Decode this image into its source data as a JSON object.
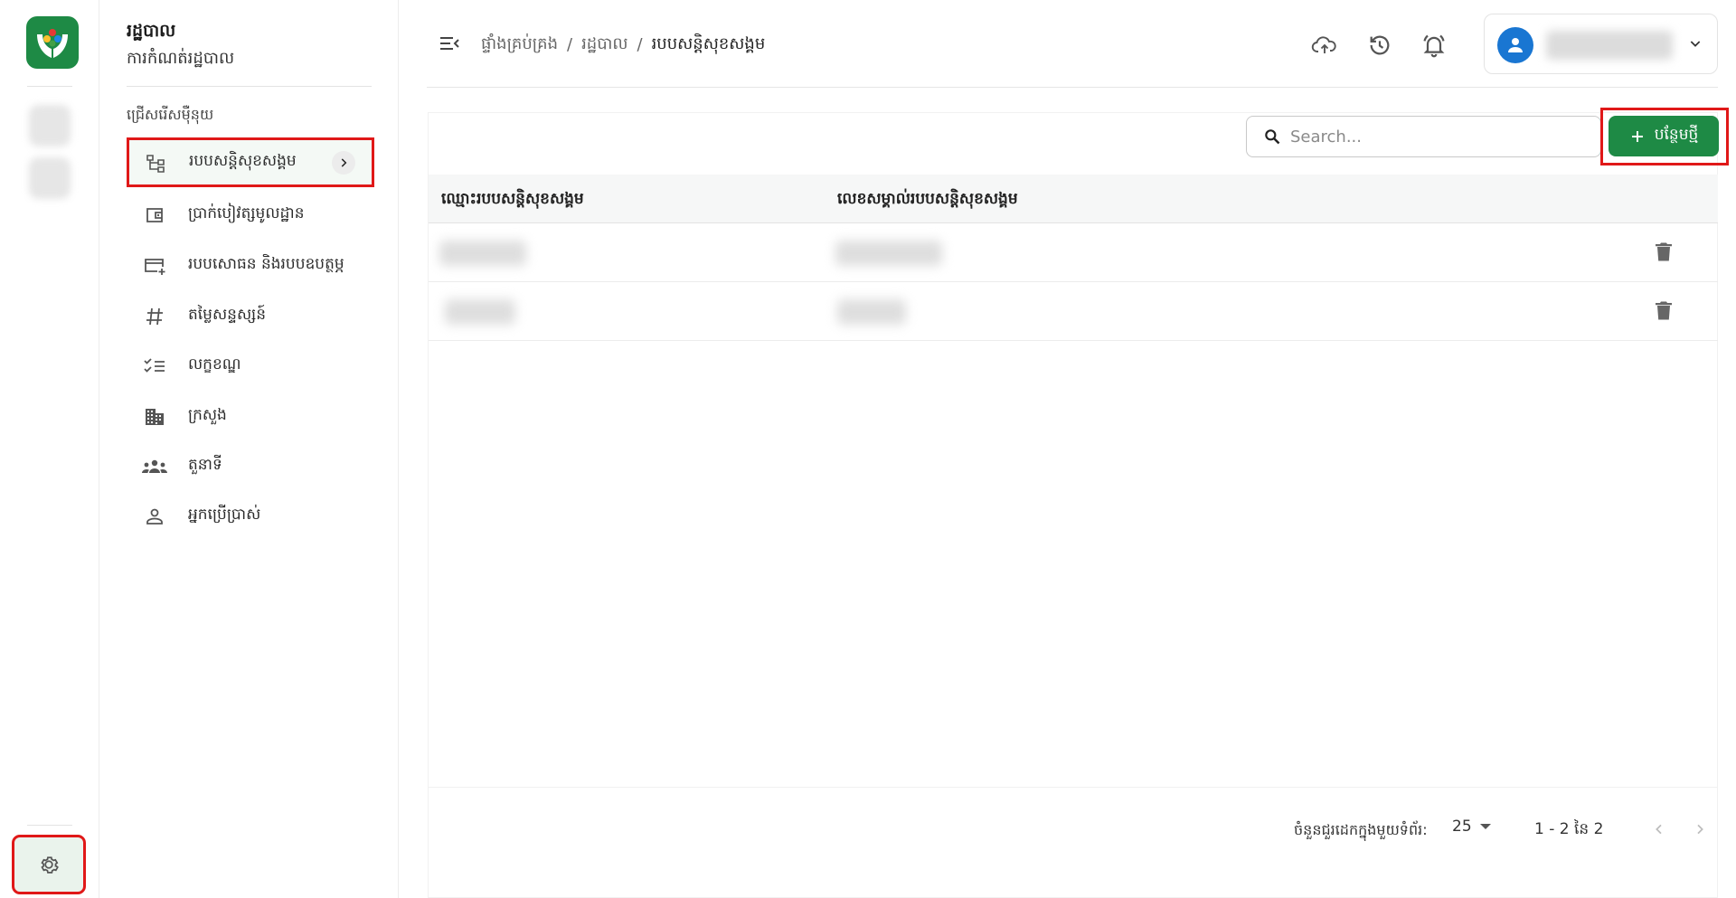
{
  "colors": {
    "brand_green": "#1e8a45",
    "highlight_red": "#e01818",
    "avatar_blue": "#1976d2"
  },
  "sidebar": {
    "title": "រដ្ឋបាល",
    "subtitle": "ការកំណត់រដ្ឋបាល",
    "section_label": "ជ្រើសរើសម៉ឺនុយ",
    "items": [
      {
        "label": "របបសន្តិសុខសង្គម",
        "icon": "hierarchy-icon",
        "active": true
      },
      {
        "label": "ប្រាក់បៀវត្សមូលដ្ឋាន",
        "icon": "wallet-icon"
      },
      {
        "label": "របបសោធន និងរបបឧបត្ថម្ភ",
        "icon": "card-plus-icon"
      },
      {
        "label": "តម្លៃសន្ទស្សន៍",
        "icon": "hash-icon"
      },
      {
        "label": "លក្ខខណ្ឌ",
        "icon": "checklist-icon"
      },
      {
        "label": "ក្រសួង",
        "icon": "building-icon"
      },
      {
        "label": "តួនាទី",
        "icon": "group-icon"
      },
      {
        "label": "អ្នកប្រើប្រាស់",
        "icon": "person-icon"
      }
    ]
  },
  "header": {
    "breadcrumb": [
      "ផ្ទាំងគ្រប់គ្រង",
      "រដ្ឋបាល",
      "របបសន្តិសុខសង្គម"
    ],
    "separator": "/"
  },
  "toolbar": {
    "search_placeholder": "Search...",
    "add_label": "បន្ថែមថ្មី"
  },
  "table": {
    "columns": [
      "ឈ្មោះរបបសន្តិសុខសង្គម",
      "លេខសម្គាល់របបសន្តិសុខសង្គម"
    ]
  },
  "pagination": {
    "rows_per_page_label": "ចំនួនជួរដេកក្នុងមួយទំព័រ:",
    "rows_per_page": "25",
    "range": "1 - 2 នៃ 2"
  }
}
